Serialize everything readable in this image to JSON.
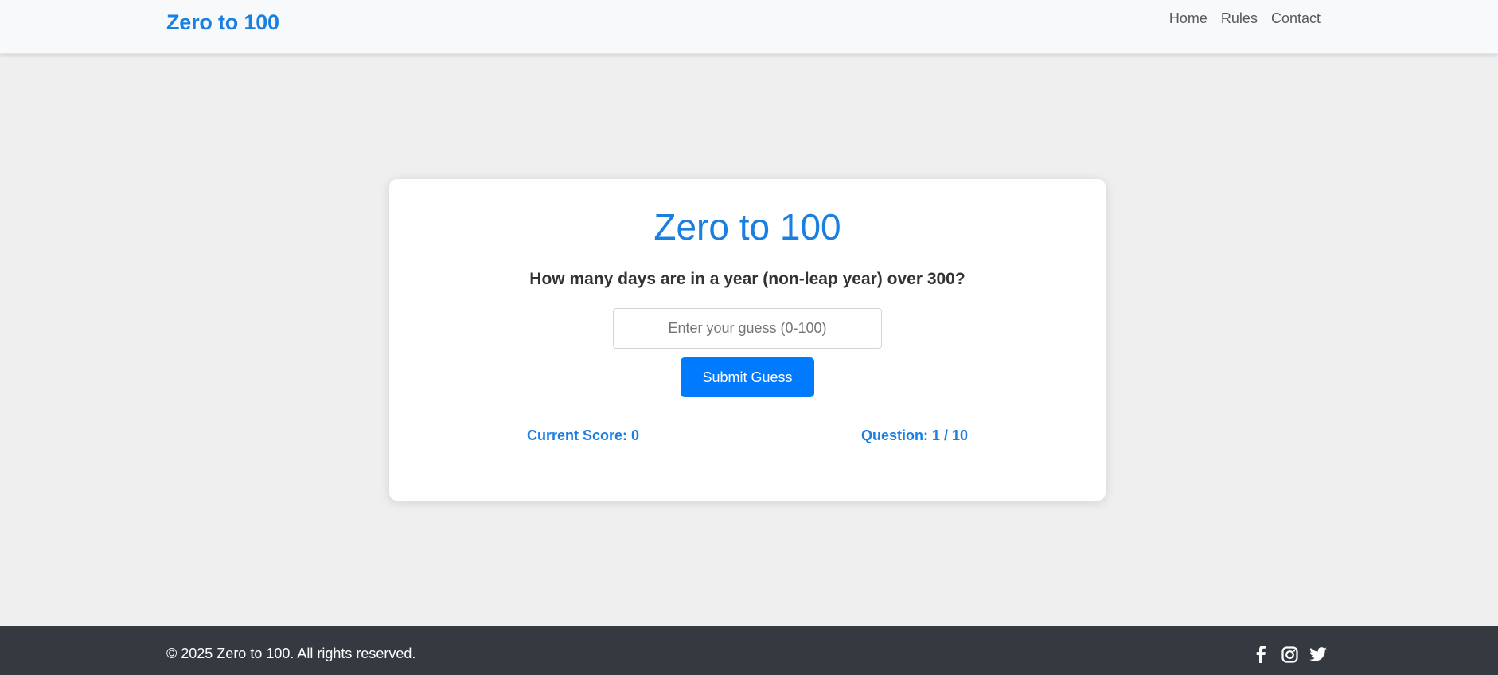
{
  "navbar": {
    "brand": "Zero to 100",
    "links": [
      {
        "label": "Home"
      },
      {
        "label": "Rules"
      },
      {
        "label": "Contact"
      }
    ]
  },
  "game": {
    "title": "Zero to 100",
    "question": "How many days are in a year (non-leap year) over 300?",
    "input": {
      "value": "",
      "placeholder": "Enter your guess (0-100)"
    },
    "submit_label": "Submit Guess",
    "score_text": "Current Score: 0",
    "progress_text": "Question: 1 / 10"
  },
  "footer": {
    "copyright": "© 2025 Zero to 100. All rights reserved.",
    "social_icons": [
      "facebook-icon",
      "instagram-icon",
      "twitter-icon"
    ]
  },
  "colors": {
    "brand_blue": "#1a7fe0",
    "button_blue": "#007bff",
    "page_bg": "#efefef",
    "navbar_bg": "#f8f9fa",
    "footer_bg": "#343a40",
    "text_dark": "#333333"
  }
}
